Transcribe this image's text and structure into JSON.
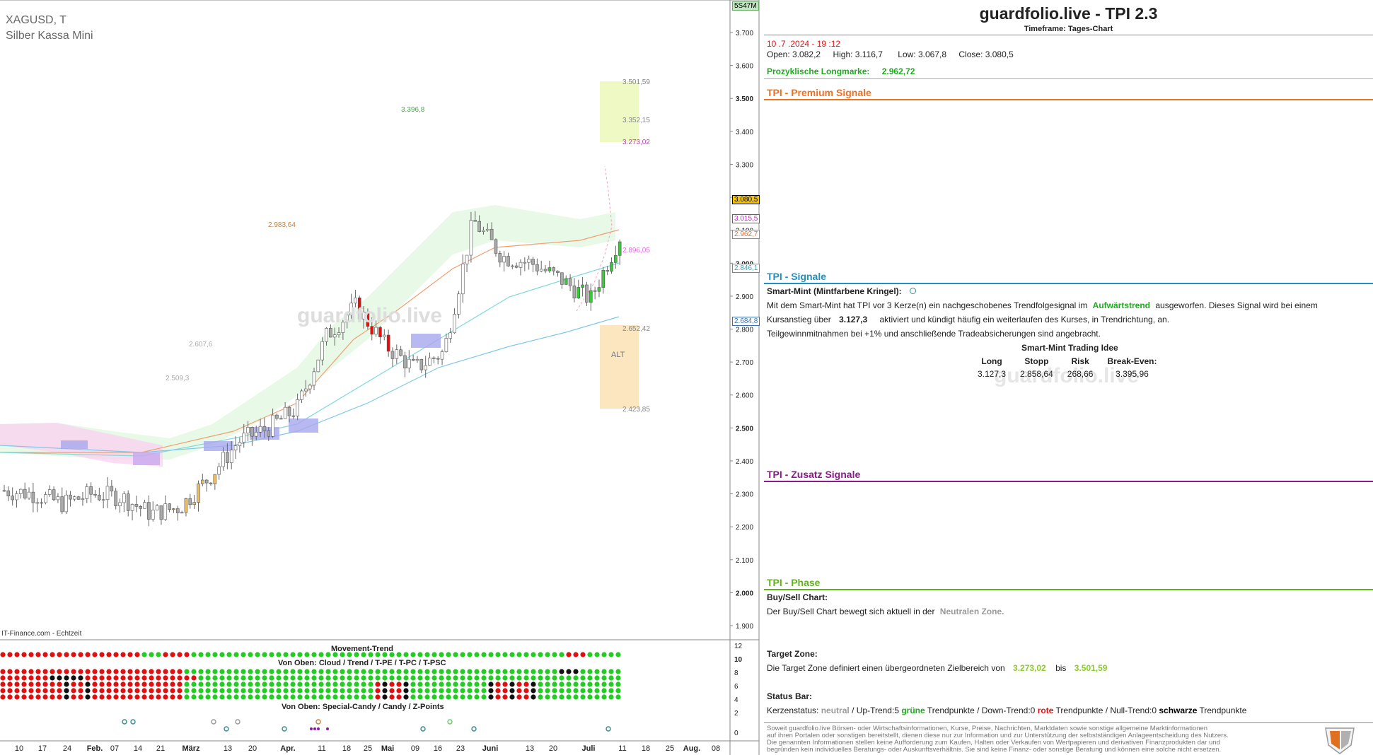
{
  "chart": {
    "symbol": "XAGUSD, T",
    "name": "Silber Kassa Mini",
    "source": "IT-Finance.com - Echtzeit",
    "top_badge": "5S47M",
    "watermark": "guardfolio.live",
    "y_ticks": [
      "3.700",
      "3.600",
      "3.500",
      "3.400",
      "3.300",
      "3.200",
      "3.100",
      "3.000",
      "2.900",
      "2.800",
      "2.700",
      "2.600",
      "2.500",
      "2.400",
      "2.300",
      "2.200",
      "2.100",
      "2.000",
      "1.900"
    ],
    "x_ticks": [
      "10",
      "17",
      "24",
      "Feb.",
      "07",
      "14",
      "21",
      "März",
      "13",
      "20",
      "Apr.",
      "11",
      "18",
      "25",
      "Mai",
      "09",
      "16",
      "23",
      "Juni",
      "13",
      "20",
      "Juli",
      "11",
      "18",
      "25",
      "Aug.",
      "08"
    ],
    "price_markers": [
      {
        "label": "3.080,5",
        "color": "#f5c400",
        "text": "#000"
      },
      {
        "label": "3.015,5",
        "color": "#ffffff",
        "text": "#c020c0"
      },
      {
        "label": "2.962,7",
        "color": "#ffffff",
        "text": "#e0703a"
      },
      {
        "label": "2.846,1",
        "color": "#ffffff",
        "text": "#3aa0c0"
      },
      {
        "label": "2.684,8",
        "color": "#ffffff",
        "text": "#3a70b0"
      }
    ],
    "zone_labels": [
      "3.501,59",
      "3.352,15",
      "3.273,02",
      "2.896,05",
      "2.652,42",
      "2.423,85"
    ],
    "alt_label": "ALT",
    "annotations": [
      "3.396,8",
      "2.983,64",
      "2.607,6",
      "2.509,3"
    ]
  },
  "chart_data": {
    "type": "line",
    "title": "",
    "xlabel": "",
    "ylabel": "",
    "ylim": [
      1850,
      3780
    ],
    "x": [
      "10",
      "17",
      "24",
      "Feb.",
      "07",
      "14",
      "21",
      "März",
      "13",
      "20",
      "Apr.",
      "11",
      "18",
      "25",
      "Mai",
      "09",
      "16",
      "23",
      "Juni",
      "13",
      "20",
      "Juli"
    ],
    "series": [
      {
        "values": [
          2310,
          2300,
          2270,
          2300,
          2290,
          2240,
          2260,
          2350,
          2460,
          2500,
          2560,
          2780,
          2870,
          2750,
          2680,
          2730,
          3130,
          3020,
          3000,
          2950,
          2890,
          3080
        ]
      }
    ]
  },
  "indicator": {
    "movement_title": "Movement-Trend",
    "cloud_title": "Von Oben: Cloud / Trend / T-PE / T-PC / T-PSC",
    "special_title": "Von Oben: Special-Candy / Candy / Z-Points",
    "scale": [
      "12",
      "10",
      "8",
      "6",
      "4",
      "2",
      "0"
    ]
  },
  "panel": {
    "title": "guardfolio.live - TPI 2.3",
    "timeframe": "Timeframe: Tages-Chart",
    "datetime": "10 .7 .2024 - 19 :12",
    "open_label": "Open:",
    "open": "3.082,2",
    "high_label": "High:",
    "high": "3.116,7",
    "low_label": "Low:",
    "low": "3.067,8",
    "close_label": "Close:",
    "close": "3.080,5",
    "longmark_label": "Prozyklische Longmarke:",
    "longmark": "2.962,72",
    "premium_title": "TPI - Premium Signale",
    "signals_title": "TPI - Signale",
    "smart_mint_label": "Smart-Mint (Mintfarbene Kringel):",
    "text1a": "Mit dem Smart-Mint hat TPI vor 3  Kerze(n) ein nachgeschobenes Trendfolgesignal im",
    "text1b": "Aufwärtstrend",
    "text1c": "ausgeworfen. Dieses Signal wird bei einem",
    "text2a": "Kursanstieg über",
    "text2b": "3.127,3",
    "text2c": "aktiviert und kündigt häufig ein weiterlaufen des Kurses, in Trendrichtung, an.",
    "text3": "Teilgewinnmitnahmen bei +1% und anschließende Tradeabsicherungen sind angebracht.",
    "idea_title": "Smart-Mint Trading Idee",
    "idea_headers": [
      "Long",
      "Stopp",
      "Risk",
      "Break-Even:"
    ],
    "idea_values": [
      "3.127,3",
      "2.858,64",
      "268,66",
      "3.395,96"
    ],
    "watermark": "guardfolio.live",
    "zusatz_title": "TPI - Zusatz Signale",
    "phase_title": "TPI - Phase",
    "buysell_label": "Buy/Sell Chart:",
    "buysell_text": "Der Buy/Sell Chart bewegt sich aktuell in der",
    "buysell_zone": "Neutralen Zone.",
    "target_label": "Target Zone:",
    "target_text": "Die Target Zone definiert einen übergeordneten Zielbereich von",
    "target_low": "3.273,02",
    "target_bis": "bis",
    "target_high": "3.501,59",
    "status_label": "Status Bar:",
    "status_prefix": "Kerzenstatus:",
    "status_neutral": "neutral",
    "status_up": "/ Up-Trend:5",
    "status_gruene": "grüne",
    "status_tp1": "Trendpunkte  / Down-Trend:0",
    "status_rote": "rote",
    "status_tp2": "Trendpunkte / Null-Trend:0",
    "status_schwarze": "schwarze",
    "status_tp3": "Trendpunkte",
    "disclaimer": [
      "Soweit guardfolio.live Börsen- oder Wirtschaftsinformationen, Kurse, Preise, Nachrichten, Marktdaten sowie sonstige allgemeine Marktinformationen",
      "auf ihren Portalen oder sonstigen bereitstellt, dienen diese nur zur Information und zur Unterstützung der selbstständigen Anlageentscheidung des Nutzers.",
      "Die genannten Informationen stellen keine Aufforderung zum Kaufen, Halten oder Verkaufen von Wertpapieren und derivativen Finanzprodukten dar und",
      "begründen kein individuelles Beratungs- oder Auskunftsverhältnis. Sie sind keine Finanz- oder sonstige Beratung und können eine solche nicht ersetzen."
    ]
  },
  "colors": {
    "brand_orange": "#f07020",
    "premium_line": "#f07020",
    "signals_line": "#2090c0",
    "zusatz_line": "#8a1a8a",
    "phase_line": "#60b020",
    "green": "#22aa22",
    "red": "#e01010"
  }
}
